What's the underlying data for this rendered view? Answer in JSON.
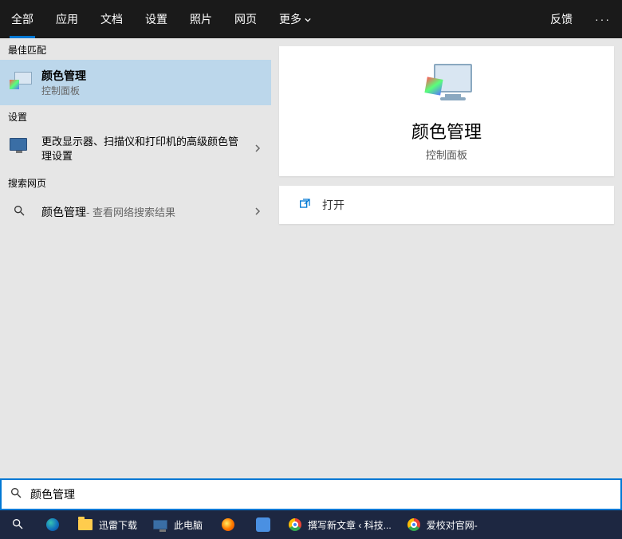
{
  "topbar": {
    "tabs": [
      "全部",
      "应用",
      "文档",
      "设置",
      "照片",
      "网页"
    ],
    "more_label": "更多",
    "feedback": "反馈"
  },
  "left": {
    "best_match_header": "最佳匹配",
    "best_match": {
      "title": "颜色管理",
      "subtitle": "控制面板"
    },
    "settings_header": "设置",
    "settings_item": {
      "title": "更改显示器、扫描仪和打印机的高级颜色管理设置"
    },
    "web_header": "搜索网页",
    "web_item": {
      "title": "颜色管理",
      "suffix": " - 查看网络搜索结果"
    }
  },
  "detail": {
    "title": "颜色管理",
    "subtitle": "控制面板",
    "open_label": "打开"
  },
  "search": {
    "value": "颜色管理"
  },
  "taskbar": {
    "items": [
      {
        "label": "迅雷下载"
      },
      {
        "label": "此电脑"
      },
      {
        "label": "撰写新文章 ‹ 科技..."
      },
      {
        "label": "爱校对官网-"
      }
    ]
  }
}
